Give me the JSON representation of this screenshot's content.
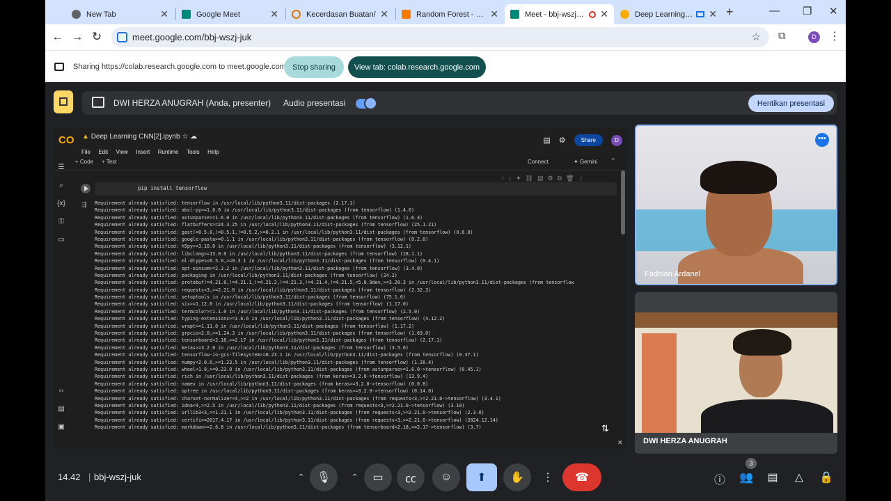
{
  "browser": {
    "tabs": [
      {
        "title": "New Tab",
        "color": "#5f6368"
      },
      {
        "title": "Google Meet",
        "color": "#00897b"
      },
      {
        "title": "Kecerdasan Buatan/",
        "color": "#e37400"
      },
      {
        "title": "Random Forest - Jupyte",
        "color": "#f57c00"
      },
      {
        "title": "Meet - bbj-wszj-juk",
        "color": "#00897b"
      },
      {
        "title": "Deep Learning CNN",
        "color": "#f9ab00"
      }
    ],
    "url": "meet.google.com/bbj-wszj-juk",
    "profile_initial": "D"
  },
  "sharing_bar": {
    "message": "Sharing https://colab.research.google.com to meet.google.com",
    "stop_label": "Stop sharing",
    "view_tab_label": "View tab: colab.research.google.com"
  },
  "presenter_bar": {
    "presenter": "DWI HERZA ANUGRAH (Anda, presenter)",
    "audio_label": "Audio presentasi",
    "audio_on": true,
    "stop_label": "Hentikan presentasi"
  },
  "colab": {
    "logo": "CO",
    "notebook_title": "Deep Learning CNN[2].ipynb",
    "menus": [
      "File",
      "Edit",
      "View",
      "Insert",
      "Runtime",
      "Tools",
      "Help"
    ],
    "share_label": "Share",
    "avatar": "D",
    "add_code": "+ Code",
    "add_text": "+ Text",
    "connect_label": "Connect",
    "gemini_label": "Gemini",
    "cell_code": "pip install tensorflow",
    "output_lines": [
      "Requirement already satisfied: tensorflow in /usr/local/lib/python3.11/dist-packages (2.17.1)",
      "Requirement already satisfied: absl-py>=1.0.0 in /usr/local/lib/python3.11/dist-packages (from tensorflow) (1.4.0)",
      "Requirement already satisfied: astunparse>=1.6.0 in /usr/local/lib/python3.11/dist-packages (from tensorflow) (1.6.3)",
      "Requirement already satisfied: flatbuffers>=24.3.25 in /usr/local/lib/python3.11/dist-packages (from tensorflow) (25.1.21)",
      "Requirement already satisfied: gast!=0.5.0,!=0.5.1,!=0.5.2,>=0.2.1 in /usr/local/lib/python3.11/dist-packages (from tensorflow) (0.6.0)",
      "Requirement already satisfied: google-pasta>=0.1.1 in /usr/local/lib/python3.11/dist-packages (from tensorflow) (0.2.0)",
      "Requirement already satisfied: h5py>=3.10.0 in /usr/local/lib/python3.11/dist-packages (from tensorflow) (3.12.1)",
      "Requirement already satisfied: libclang>=13.0.0 in /usr/local/lib/python3.11/dist-packages (from tensorflow) (18.1.1)",
      "Requirement already satisfied: ml-dtypes<0.5.0,>=0.3.1 in /usr/local/lib/python3.11/dist-packages (from tensorflow) (0.4.1)",
      "Requirement already satisfied: opt-einsum>=2.3.2 in /usr/local/lib/python3.11/dist-packages (from tensorflow) (3.4.0)",
      "Requirement already satisfied: packaging in /usr/local/lib/python3.11/dist-packages (from tensorflow) (24.2)",
      "Requirement already satisfied: protobuf!=4.21.0,!=4.21.1,!=4.21.2,!=4.21.3,!=4.21.4,!=4.21.5,<5.0.0dev,>=3.20.3 in /usr/local/lib/python3.11/dist-packages (from tensorflow",
      "Requirement already satisfied: requests<3,>=2.21.0 in /usr/local/lib/python3.11/dist-packages (from tensorflow) (2.32.3)",
      "Requirement already satisfied: setuptools in /usr/local/lib/python3.11/dist-packages (from tensorflow) (75.1.0)",
      "Requirement already satisfied: six>=1.12.0 in /usr/local/lib/python3.11/dist-packages (from tensorflow) (1.17.0)",
      "Requirement already satisfied: termcolor>=1.1.0 in /usr/local/lib/python3.11/dist-packages (from tensorflow) (2.5.0)",
      "Requirement already satisfied: typing-extensions>=3.6.6 in /usr/local/lib/python3.11/dist-packages (from tensorflow) (4.12.2)",
      "Requirement already satisfied: wrapt>=1.11.0 in /usr/local/lib/python3.11/dist-packages (from tensorflow) (1.17.2)",
      "Requirement already satisfied: grpcio<2.0,>=1.24.3 in /usr/local/lib/python3.11/dist-packages (from tensorflow) (1.69.0)",
      "Requirement already satisfied: tensorboard<2.18,>=2.17 in /usr/local/lib/python3.11/dist-packages (from tensorflow) (2.17.1)",
      "Requirement already satisfied: keras>=3.2.0 in /usr/local/lib/python3.11/dist-packages (from tensorflow) (3.5.0)",
      "Requirement already satisfied: tensorflow-io-gcs-filesystem>=0.23.1 in /usr/local/lib/python3.11/dist-packages (from tensorflow) (0.37.1)",
      "Requirement already satisfied: numpy<2.0.0,>=1.23.5 in /usr/local/lib/python3.11/dist-packages (from tensorflow) (1.26.4)",
      "Requirement already satisfied: wheel<1.0,>=0.23.0 in /usr/local/lib/python3.11/dist-packages (from astunparse>=1.6.0->tensorflow) (0.45.1)",
      "Requirement already satisfied: rich in /usr/local/lib/python3.11/dist-packages (from keras>=3.2.0->tensorflow) (13.9.4)",
      "Requirement already satisfied: namex in /usr/local/lib/python3.11/dist-packages (from keras>=3.2.0->tensorflow) (0.0.8)",
      "Requirement already satisfied: optree in /usr/local/lib/python3.11/dist-packages (from keras>=3.2.0->tensorflow) (0.14.0)",
      "Requirement already satisfied: charset-normalizer<4,>=2 in /usr/local/lib/python3.11/dist-packages (from requests<3,>=2.21.0->tensorflow) (3.4.1)",
      "Requirement already satisfied: idna<4,>=2.5 in /usr/local/lib/python3.11/dist-packages (from requests<3,>=2.21.0->tensorflow) (3.10)",
      "Requirement already satisfied: urllib3<3,>=1.21.1 in /usr/local/lib/python3.11/dist-packages (from requests<3,>=2.21.0->tensorflow) (2.3.0)",
      "Requirement already satisfied: certifi>=2017.4.17 in /usr/local/lib/python3.11/dist-packages (from requests<3,>=2.21.0->tensorflow) (2024.12.14)",
      "Requirement already satisfied: markdown>=2.6.8 in /usr/local/lib/python3.11/dist-packages (from tensorboard<2.18,>=2.17->tensorflow) (3.7)"
    ]
  },
  "participants": [
    {
      "name": "Fadhlan Ardanel"
    },
    {
      "name": "DWI HERZA ANUGRAH"
    }
  ],
  "bottom_bar": {
    "time": "14.42",
    "separator": "|",
    "meeting_code": "bbj-wszj-juk",
    "participant_count": "3"
  },
  "icons": {
    "mic": "mic-icon",
    "camera": "camera-icon",
    "captions": "captions-icon",
    "emoji": "emoji-icon",
    "present": "present-icon",
    "hand": "raise-hand-icon",
    "more": "more-icon",
    "end": "end-call-icon",
    "info": "info-icon",
    "people": "people-icon",
    "chat": "chat-icon",
    "activities": "activities-icon",
    "host": "host-controls-icon"
  }
}
